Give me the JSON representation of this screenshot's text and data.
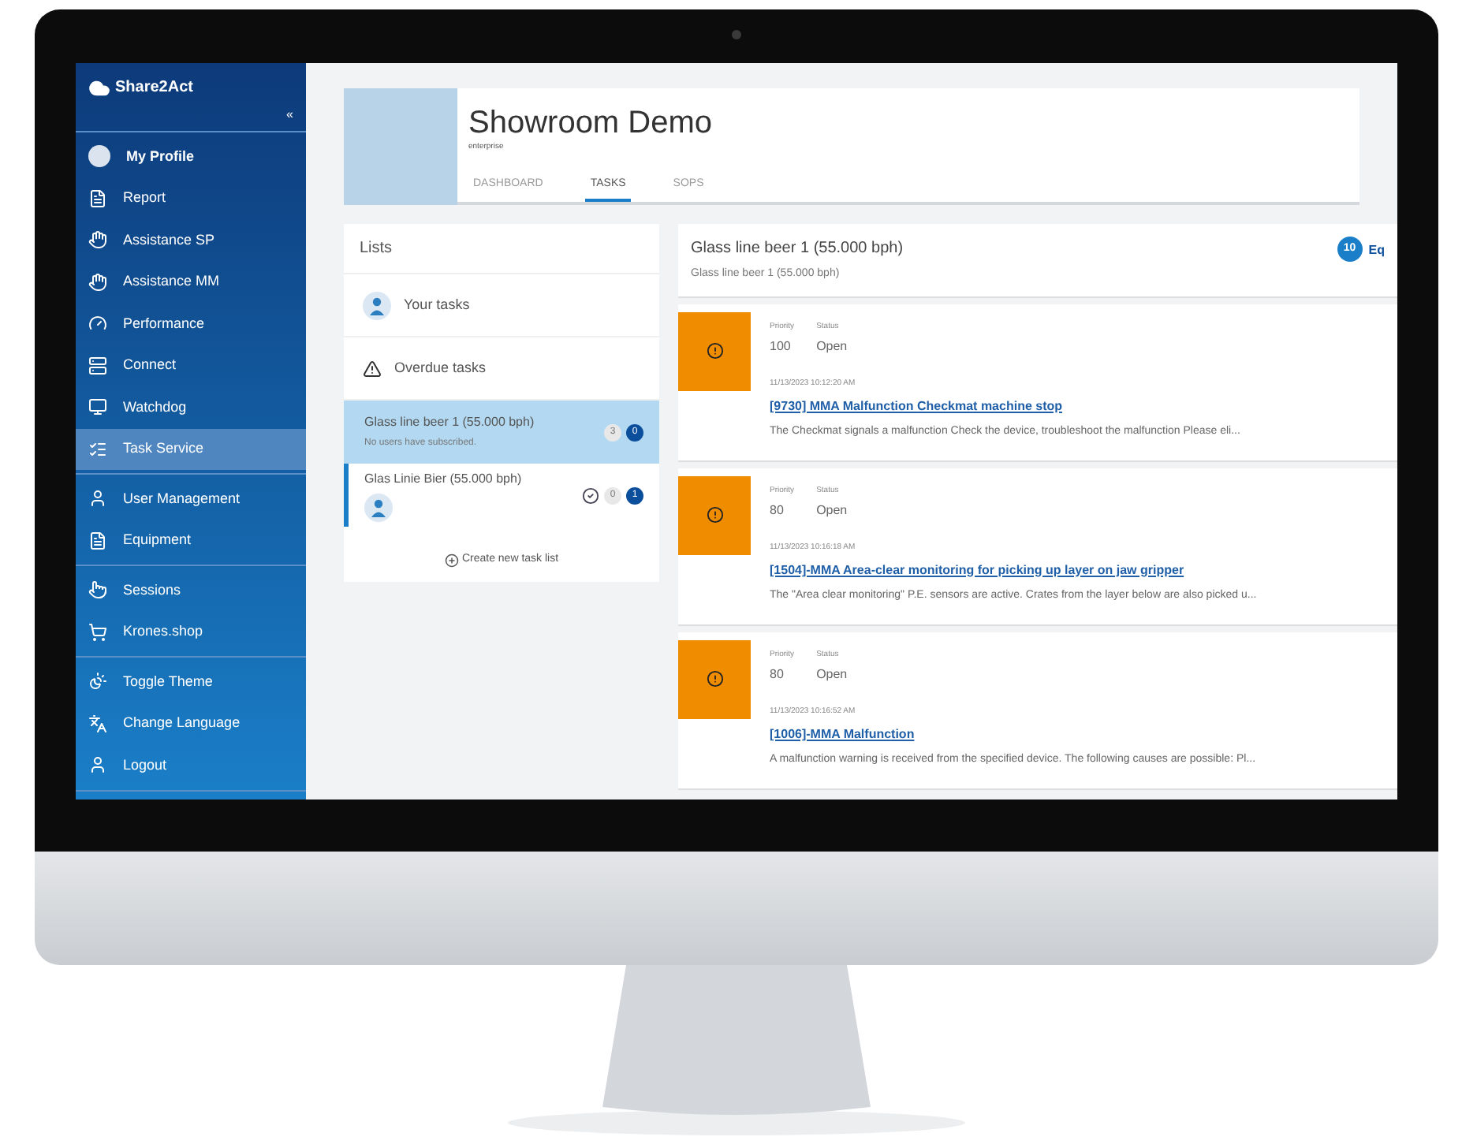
{
  "sidebar": {
    "brand": "Share2Act",
    "collapse": "«",
    "sections": [
      [
        {
          "label": "My Profile",
          "kind": "avatar",
          "selected": false
        },
        {
          "label": "Report",
          "kind": "report",
          "selected": false
        },
        {
          "label": "Assistance SP",
          "kind": "hand",
          "selected": false
        },
        {
          "label": "Assistance MM",
          "kind": "hand",
          "selected": false
        },
        {
          "label": "Performance",
          "kind": "gauge",
          "selected": false
        },
        {
          "label": "Connect",
          "kind": "server",
          "selected": false
        },
        {
          "label": "Watchdog",
          "kind": "monitor",
          "selected": false
        },
        {
          "label": "Task Service",
          "kind": "list",
          "selected": true
        }
      ],
      [
        {
          "label": "User Management",
          "kind": "user",
          "selected": false
        },
        {
          "label": "Equipment",
          "kind": "report",
          "selected": false
        }
      ],
      [
        {
          "label": "Sessions",
          "kind": "touch",
          "selected": false
        },
        {
          "label": "Krones.shop",
          "kind": "cart",
          "selected": false
        }
      ],
      [
        {
          "label": "Toggle Theme",
          "kind": "theme",
          "selected": false
        },
        {
          "label": "Change Language",
          "kind": "language",
          "selected": false
        },
        {
          "label": "Logout",
          "kind": "user",
          "selected": false
        }
      ]
    ]
  },
  "header": {
    "title": "Showroom Demo",
    "subtitle": "enterprise",
    "tabs": [
      {
        "label": "DASHBOARD",
        "selected": false
      },
      {
        "label": "TASKS",
        "selected": true
      },
      {
        "label": "SOPS",
        "selected": false
      }
    ]
  },
  "lists": {
    "title": "Lists",
    "fixed": [
      {
        "label": "Your tasks",
        "kind": "person"
      },
      {
        "label": "Overdue tasks",
        "kind": "warning"
      }
    ],
    "items": [
      {
        "name": "Glass line beer 1 (55.000 bph)",
        "note": "No users have subscribed.",
        "selected": true,
        "accent": false,
        "subscribed": false,
        "count_done": "3",
        "count_open": "0"
      },
      {
        "name": "Glas Linie Bier (55.000 bph)",
        "selected": false,
        "accent": true,
        "subscribed": true,
        "count_done": "0",
        "count_open": "1"
      }
    ],
    "create": "Create new task list"
  },
  "tasks": {
    "title": "Glass line beer 1 (55.000 bph)",
    "subtitle": "Glass line beer 1 (55.000 bph)",
    "count": "10",
    "side_label": "Eq",
    "items": [
      {
        "priority_label": "Priority",
        "status_label": "Status",
        "priority": "100",
        "status": "Open",
        "date": "11/13/2023 10:12:20 AM",
        "title": "[9730] MMA Malfunction Checkmat machine stop",
        "description": "The Checkmat signals a malfunction Check the device, troubleshoot the malfunction Please eli..."
      },
      {
        "priority_label": "Priority",
        "status_label": "Status",
        "priority": "80",
        "status": "Open",
        "date": "11/13/2023 10:16:18 AM",
        "title": "[1504]-MMA Area-clear monitoring for picking up layer on jaw gripper",
        "description": "The \"Area clear monitoring\" P.E. sensors are active. Crates from the layer below are also picked u..."
      },
      {
        "priority_label": "Priority",
        "status_label": "Status",
        "priority": "80",
        "status": "Open",
        "date": "11/13/2023 10:16:52 AM",
        "title": "[1006]-MMA Malfunction",
        "description": "A malfunction warning is received from the specified device. The following causes are possible: Pl..."
      }
    ]
  }
}
